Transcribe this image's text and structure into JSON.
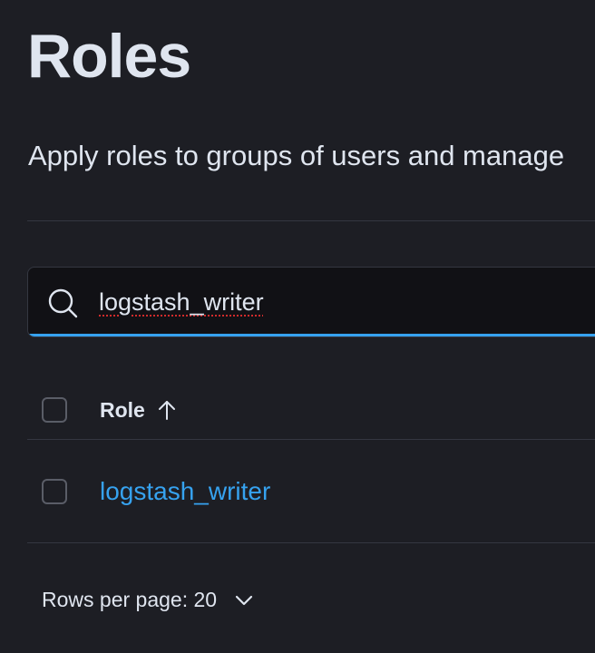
{
  "page": {
    "title": "Roles",
    "description": "Apply roles to groups of users and manage"
  },
  "search": {
    "value": "logstash_writer",
    "icon": "search-icon"
  },
  "table": {
    "columns": [
      {
        "label": "Role",
        "sort": "ascending",
        "sort_icon": "arrow-up-icon"
      }
    ],
    "rows": [
      {
        "role": "logstash_writer",
        "selected": false
      }
    ]
  },
  "pagination": {
    "rows_per_page_label": "Rows per page: 20",
    "icon": "chevron-down-icon"
  },
  "colors": {
    "background": "#1d1e24",
    "text": "#dfe5ef",
    "accent": "#36a2ef",
    "border": "#343741",
    "input_bg": "#111115"
  }
}
